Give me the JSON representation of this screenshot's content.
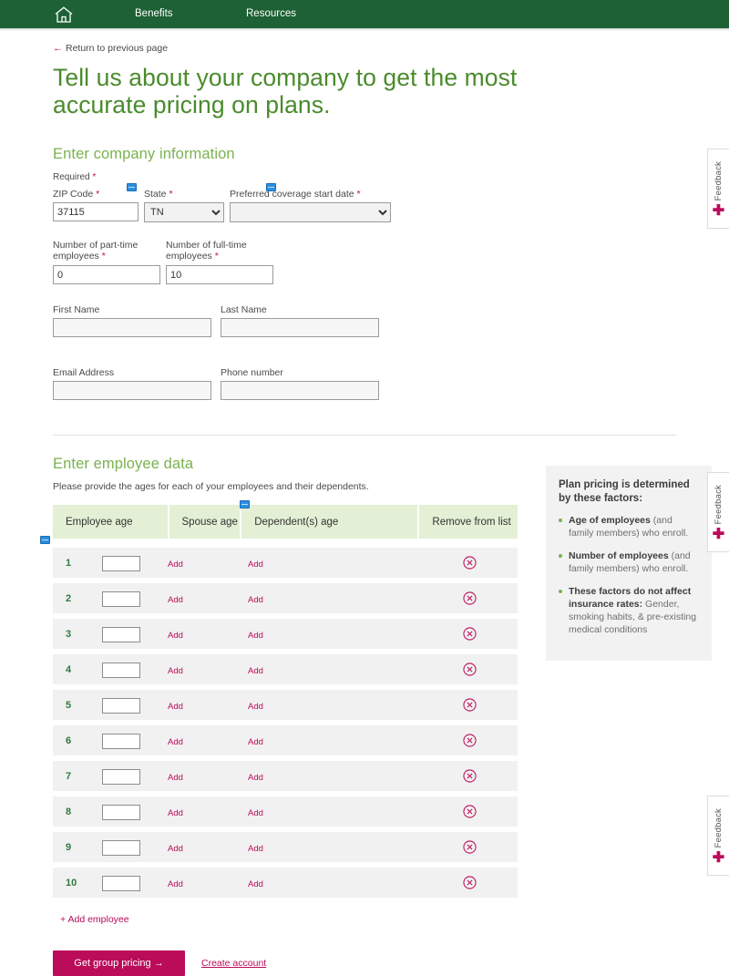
{
  "nav": {
    "home_icon": "home-icon",
    "links": [
      {
        "label": "Benefits"
      },
      {
        "label": "Resources"
      }
    ]
  },
  "breadcrumb": {
    "arrow": "←",
    "label": "Return to previous page"
  },
  "page": {
    "title": "Tell us about your company to get the most accurate pricing on plans."
  },
  "company_section": {
    "title": "Enter company information",
    "required_note": "Required",
    "required_star": "*",
    "fields": {
      "zip": {
        "label": "ZIP Code",
        "value": "37115",
        "required": "*"
      },
      "state": {
        "label": "State",
        "value": "TN",
        "required": "*"
      },
      "start_date": {
        "label": "Preferred coverage start date",
        "value": "",
        "required": "*"
      },
      "part_time": {
        "label": "Number of part-time employees",
        "value": "0",
        "required": "*"
      },
      "full_time": {
        "label": "Number of full-time employees",
        "value": "10",
        "required": "*"
      },
      "first_name": {
        "label": "First Name",
        "value": ""
      },
      "last_name": {
        "label": "Last Name",
        "value": ""
      },
      "email": {
        "label": "Email Address",
        "value": ""
      },
      "phone": {
        "label": "Phone number",
        "value": ""
      }
    }
  },
  "employee_section": {
    "title": "Enter employee data",
    "subtitle": "Please provide the ages for each of your employees and their dependents.",
    "columns": [
      "Employee age",
      "Spouse age",
      "Dependent(s) age",
      "Remove from list"
    ],
    "add_link_label": "Add",
    "remove_icon": "circle-x-icon",
    "rows": [
      {
        "num": "1",
        "age": "",
        "spouse": "Add",
        "dependents": "Add"
      },
      {
        "num": "2",
        "age": "",
        "spouse": "Add",
        "dependents": "Add"
      },
      {
        "num": "3",
        "age": "",
        "spouse": "Add",
        "dependents": "Add"
      },
      {
        "num": "4",
        "age": "",
        "spouse": "Add",
        "dependents": "Add"
      },
      {
        "num": "5",
        "age": "",
        "spouse": "Add",
        "dependents": "Add"
      },
      {
        "num": "6",
        "age": "",
        "spouse": "Add",
        "dependents": "Add"
      },
      {
        "num": "7",
        "age": "",
        "spouse": "Add",
        "dependents": "Add"
      },
      {
        "num": "8",
        "age": "",
        "spouse": "Add",
        "dependents": "Add"
      },
      {
        "num": "9",
        "age": "",
        "spouse": "Add",
        "dependents": "Add"
      },
      {
        "num": "10",
        "age": "",
        "spouse": "Add",
        "dependents": "Add"
      }
    ],
    "add_employee_label": "+ Add employee"
  },
  "actions": {
    "submit_label": "Get group pricing →",
    "create_account_label": "Create account"
  },
  "info_panel": {
    "title": "Plan pricing is determined by these factors:",
    "items": [
      {
        "bold": "Age of employees",
        "rest": " (and family members) who enroll."
      },
      {
        "bold": "Number of employees",
        "rest": " (and family members) who enroll."
      },
      {
        "bold": "These factors do not affect insurance rates:",
        "rest": " Gender, smoking habits, & pre-existing medical conditions"
      }
    ]
  },
  "feedback": {
    "label": "Feedback",
    "plus": "✚"
  },
  "colors": {
    "nav_green": "#1e6135",
    "heading_green": "#4a8b2c",
    "section_green": "#7ab24f",
    "magenta": "#ba0c59",
    "table_header_green": "#e3f0d5",
    "row_gray": "#f1f1f1",
    "marker_blue": "#2a8fe0"
  }
}
